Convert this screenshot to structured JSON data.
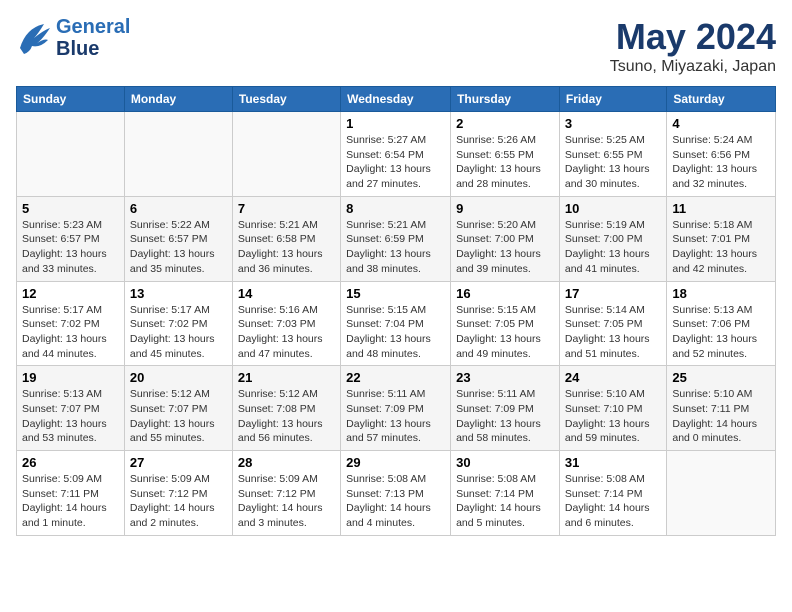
{
  "header": {
    "logo_line1": "General",
    "logo_line2": "Blue",
    "title": "May 2024",
    "location": "Tsuno, Miyazaki, Japan"
  },
  "weekdays": [
    "Sunday",
    "Monday",
    "Tuesday",
    "Wednesday",
    "Thursday",
    "Friday",
    "Saturday"
  ],
  "weeks": [
    [
      {
        "day": "",
        "info": ""
      },
      {
        "day": "",
        "info": ""
      },
      {
        "day": "",
        "info": ""
      },
      {
        "day": "1",
        "info": "Sunrise: 5:27 AM\nSunset: 6:54 PM\nDaylight: 13 hours\nand 27 minutes."
      },
      {
        "day": "2",
        "info": "Sunrise: 5:26 AM\nSunset: 6:55 PM\nDaylight: 13 hours\nand 28 minutes."
      },
      {
        "day": "3",
        "info": "Sunrise: 5:25 AM\nSunset: 6:55 PM\nDaylight: 13 hours\nand 30 minutes."
      },
      {
        "day": "4",
        "info": "Sunrise: 5:24 AM\nSunset: 6:56 PM\nDaylight: 13 hours\nand 32 minutes."
      }
    ],
    [
      {
        "day": "5",
        "info": "Sunrise: 5:23 AM\nSunset: 6:57 PM\nDaylight: 13 hours\nand 33 minutes."
      },
      {
        "day": "6",
        "info": "Sunrise: 5:22 AM\nSunset: 6:57 PM\nDaylight: 13 hours\nand 35 minutes."
      },
      {
        "day": "7",
        "info": "Sunrise: 5:21 AM\nSunset: 6:58 PM\nDaylight: 13 hours\nand 36 minutes."
      },
      {
        "day": "8",
        "info": "Sunrise: 5:21 AM\nSunset: 6:59 PM\nDaylight: 13 hours\nand 38 minutes."
      },
      {
        "day": "9",
        "info": "Sunrise: 5:20 AM\nSunset: 7:00 PM\nDaylight: 13 hours\nand 39 minutes."
      },
      {
        "day": "10",
        "info": "Sunrise: 5:19 AM\nSunset: 7:00 PM\nDaylight: 13 hours\nand 41 minutes."
      },
      {
        "day": "11",
        "info": "Sunrise: 5:18 AM\nSunset: 7:01 PM\nDaylight: 13 hours\nand 42 minutes."
      }
    ],
    [
      {
        "day": "12",
        "info": "Sunrise: 5:17 AM\nSunset: 7:02 PM\nDaylight: 13 hours\nand 44 minutes."
      },
      {
        "day": "13",
        "info": "Sunrise: 5:17 AM\nSunset: 7:02 PM\nDaylight: 13 hours\nand 45 minutes."
      },
      {
        "day": "14",
        "info": "Sunrise: 5:16 AM\nSunset: 7:03 PM\nDaylight: 13 hours\nand 47 minutes."
      },
      {
        "day": "15",
        "info": "Sunrise: 5:15 AM\nSunset: 7:04 PM\nDaylight: 13 hours\nand 48 minutes."
      },
      {
        "day": "16",
        "info": "Sunrise: 5:15 AM\nSunset: 7:05 PM\nDaylight: 13 hours\nand 49 minutes."
      },
      {
        "day": "17",
        "info": "Sunrise: 5:14 AM\nSunset: 7:05 PM\nDaylight: 13 hours\nand 51 minutes."
      },
      {
        "day": "18",
        "info": "Sunrise: 5:13 AM\nSunset: 7:06 PM\nDaylight: 13 hours\nand 52 minutes."
      }
    ],
    [
      {
        "day": "19",
        "info": "Sunrise: 5:13 AM\nSunset: 7:07 PM\nDaylight: 13 hours\nand 53 minutes."
      },
      {
        "day": "20",
        "info": "Sunrise: 5:12 AM\nSunset: 7:07 PM\nDaylight: 13 hours\nand 55 minutes."
      },
      {
        "day": "21",
        "info": "Sunrise: 5:12 AM\nSunset: 7:08 PM\nDaylight: 13 hours\nand 56 minutes."
      },
      {
        "day": "22",
        "info": "Sunrise: 5:11 AM\nSunset: 7:09 PM\nDaylight: 13 hours\nand 57 minutes."
      },
      {
        "day": "23",
        "info": "Sunrise: 5:11 AM\nSunset: 7:09 PM\nDaylight: 13 hours\nand 58 minutes."
      },
      {
        "day": "24",
        "info": "Sunrise: 5:10 AM\nSunset: 7:10 PM\nDaylight: 13 hours\nand 59 minutes."
      },
      {
        "day": "25",
        "info": "Sunrise: 5:10 AM\nSunset: 7:11 PM\nDaylight: 14 hours\nand 0 minutes."
      }
    ],
    [
      {
        "day": "26",
        "info": "Sunrise: 5:09 AM\nSunset: 7:11 PM\nDaylight: 14 hours\nand 1 minute."
      },
      {
        "day": "27",
        "info": "Sunrise: 5:09 AM\nSunset: 7:12 PM\nDaylight: 14 hours\nand 2 minutes."
      },
      {
        "day": "28",
        "info": "Sunrise: 5:09 AM\nSunset: 7:12 PM\nDaylight: 14 hours\nand 3 minutes."
      },
      {
        "day": "29",
        "info": "Sunrise: 5:08 AM\nSunset: 7:13 PM\nDaylight: 14 hours\nand 4 minutes."
      },
      {
        "day": "30",
        "info": "Sunrise: 5:08 AM\nSunset: 7:14 PM\nDaylight: 14 hours\nand 5 minutes."
      },
      {
        "day": "31",
        "info": "Sunrise: 5:08 AM\nSunset: 7:14 PM\nDaylight: 14 hours\nand 6 minutes."
      },
      {
        "day": "",
        "info": ""
      }
    ]
  ]
}
